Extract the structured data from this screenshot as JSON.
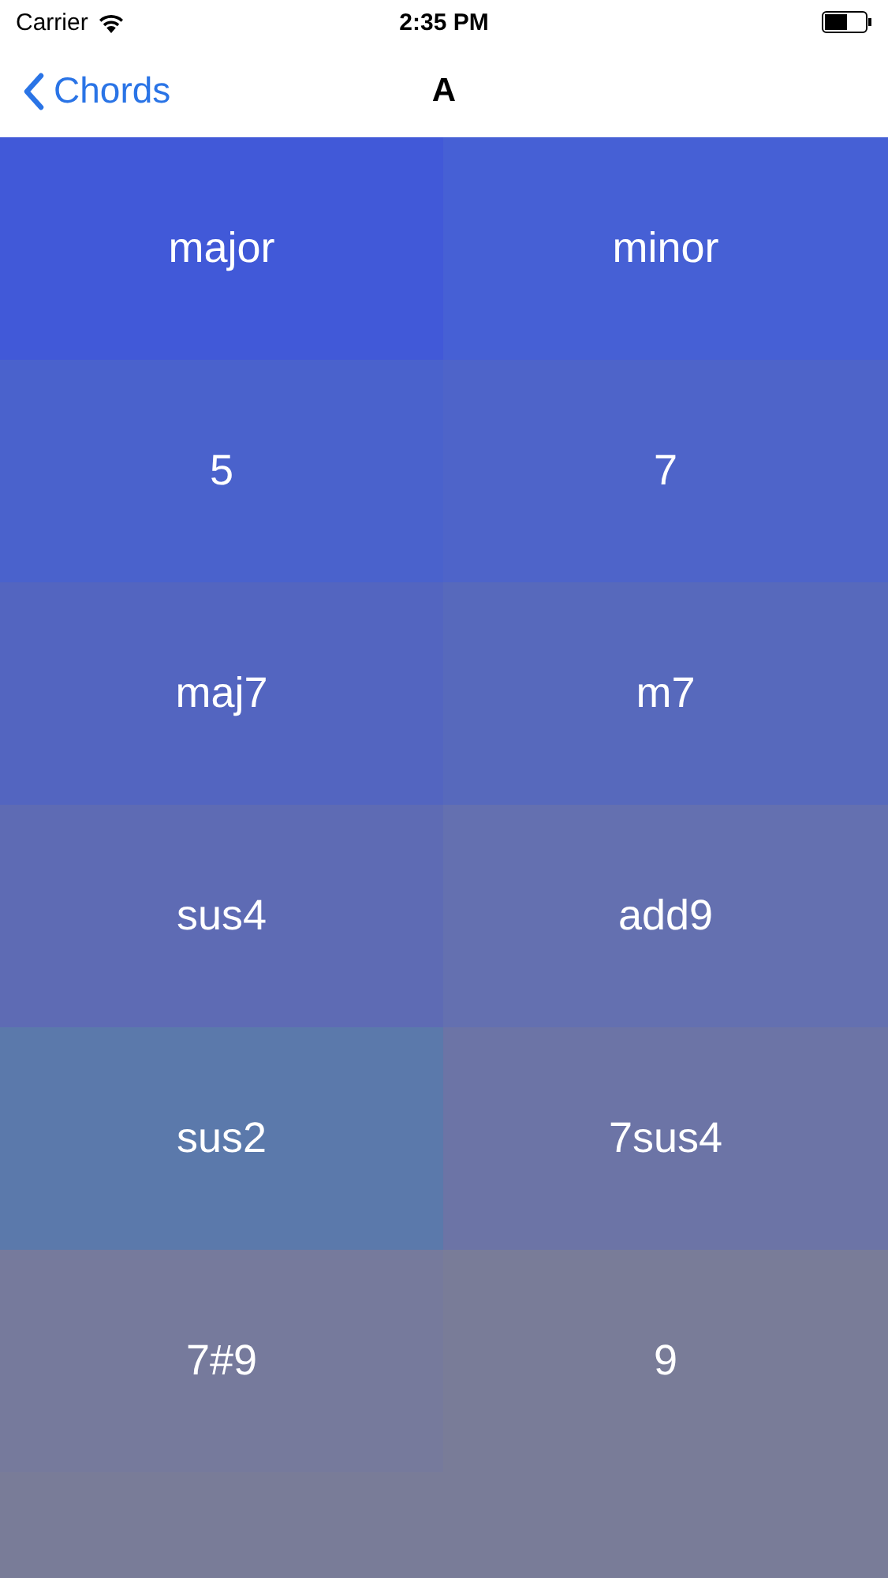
{
  "status_bar": {
    "carrier": "Carrier",
    "time": "2:35 PM"
  },
  "nav_bar": {
    "back": "Chords",
    "title": "A"
  },
  "chords": [
    {
      "label": "major",
      "color": "#4159d8"
    },
    {
      "label": "minor",
      "color": "#4660d5"
    },
    {
      "label": "5",
      "color": "#4a62cc"
    },
    {
      "label": "7",
      "color": "#4e64c9"
    },
    {
      "label": "maj7",
      "color": "#5365c0"
    },
    {
      "label": "m7",
      "color": "#5769bc"
    },
    {
      "label": "sus4",
      "color": "#5e6bb4"
    },
    {
      "label": "add9",
      "color": "#6470b0"
    },
    {
      "label": "sus2",
      "color": "#5b79ab"
    },
    {
      "label": "7sus4",
      "color": "#6c74a6"
    },
    {
      "label": "7#9",
      "color": "#767a9c"
    },
    {
      "label": "9",
      "color": "#797c98"
    }
  ]
}
